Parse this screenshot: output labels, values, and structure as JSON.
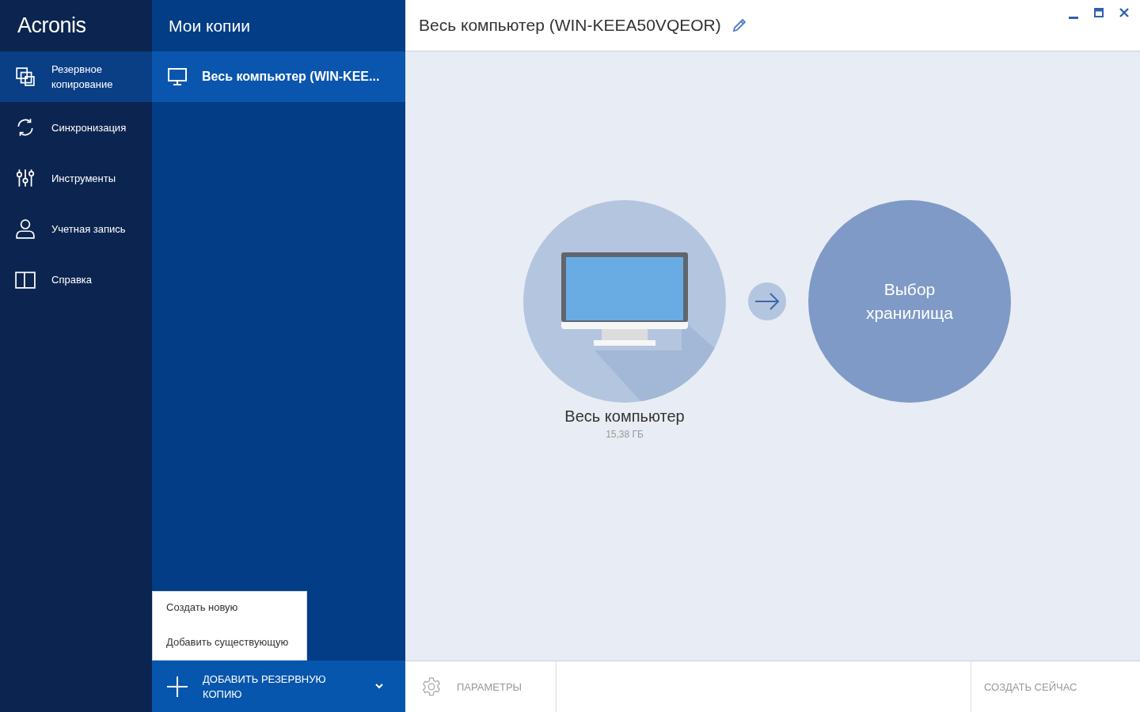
{
  "brand": "Acronis",
  "nav": [
    {
      "label": "Резервное копирование",
      "kind": "backup",
      "selected": true
    },
    {
      "label": "Синхронизация",
      "kind": "sync",
      "selected": false
    },
    {
      "label": "Инструменты",
      "kind": "tools",
      "selected": false
    },
    {
      "label": "Учетная запись",
      "kind": "account",
      "selected": false
    },
    {
      "label": "Справка",
      "kind": "help",
      "selected": false
    }
  ],
  "copies": {
    "title": "Мои копии",
    "items": [
      {
        "label": "Весь компьютер (WIN-KEE...",
        "selected": true
      }
    ]
  },
  "add_menu": [
    "Создать новую",
    "Добавить существующую"
  ],
  "add_button": {
    "label": "ДОБАВИТЬ РЕЗЕРВНУЮ КОПИЮ"
  },
  "header": {
    "title": "Весь компьютер (WIN-KEEA50VQEOR)"
  },
  "source": {
    "label": "Весь компьютер",
    "size": "15,38 ГБ"
  },
  "destination": {
    "label": "Выбор хранилища"
  },
  "footer": {
    "settings": "ПАРАМЕТРЫ",
    "action": "СОЗДАТЬ СЕЙЧАС"
  }
}
